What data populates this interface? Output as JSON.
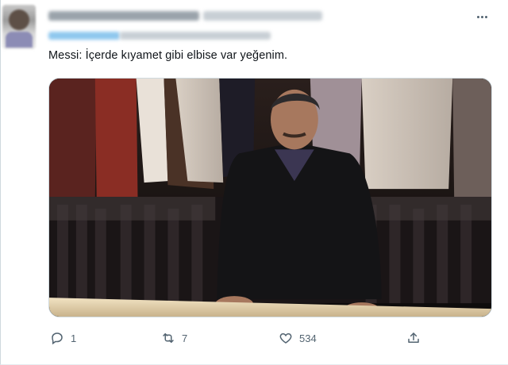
{
  "tweet": {
    "text": "Messi: İçerde kıyamet gibi elbise var yeğenim."
  },
  "actions": {
    "reply_count": "1",
    "retweet_count": "7",
    "like_count": "534"
  },
  "icons": {
    "more": "more-horizontal-icon",
    "reply": "reply-icon",
    "retweet": "retweet-icon",
    "like": "heart-icon",
    "share": "share-icon"
  }
}
